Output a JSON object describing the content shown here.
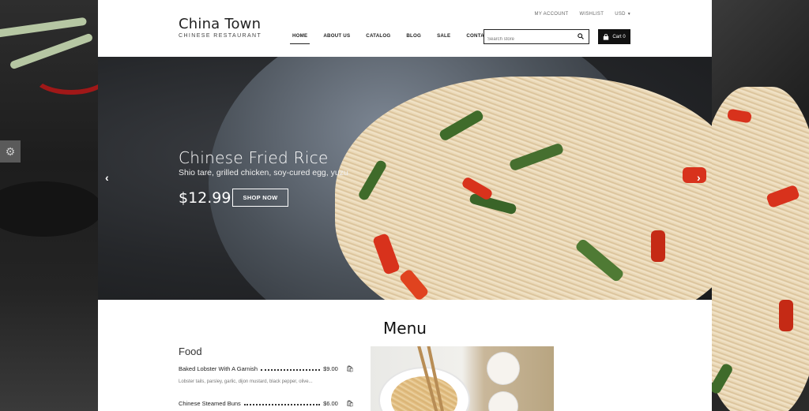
{
  "brand": {
    "title": "China Town",
    "subtitle": "CHINESE RESTAURANT"
  },
  "top_links": {
    "account": "MY ACCOUNT",
    "wishlist": "WISHLIST",
    "currency": "USD"
  },
  "nav": [
    {
      "label": "HOME",
      "active": true
    },
    {
      "label": "ABOUT US"
    },
    {
      "label": "CATALOG"
    },
    {
      "label": "BLOG"
    },
    {
      "label": "SALE"
    },
    {
      "label": "CONTACT US"
    }
  ],
  "search": {
    "placeholder": "Search store"
  },
  "cart": {
    "label": "Cart 0"
  },
  "hero": {
    "title": "Chinese Fried Rice",
    "subtitle": "Shio tare, grilled chicken, soy-cured egg, yuzu",
    "price": "$12.99",
    "button": "SHOP NOW",
    "prev_arrow": "‹",
    "next_arrow": "›"
  },
  "menu": {
    "title": "Menu",
    "section": "Food",
    "items": [
      {
        "name": "Baked Lobster With A Garnish",
        "price": "$9.00",
        "desc": "Lobster tails, parsley, garlic, dijon mustard, black pepper, olive..."
      },
      {
        "name": "Chinese Steamed Buns",
        "price": "$6.00"
      }
    ]
  },
  "settings_icon": "gear-icon",
  "colors": {
    "accent": "#111111",
    "background": "#ffffff"
  }
}
